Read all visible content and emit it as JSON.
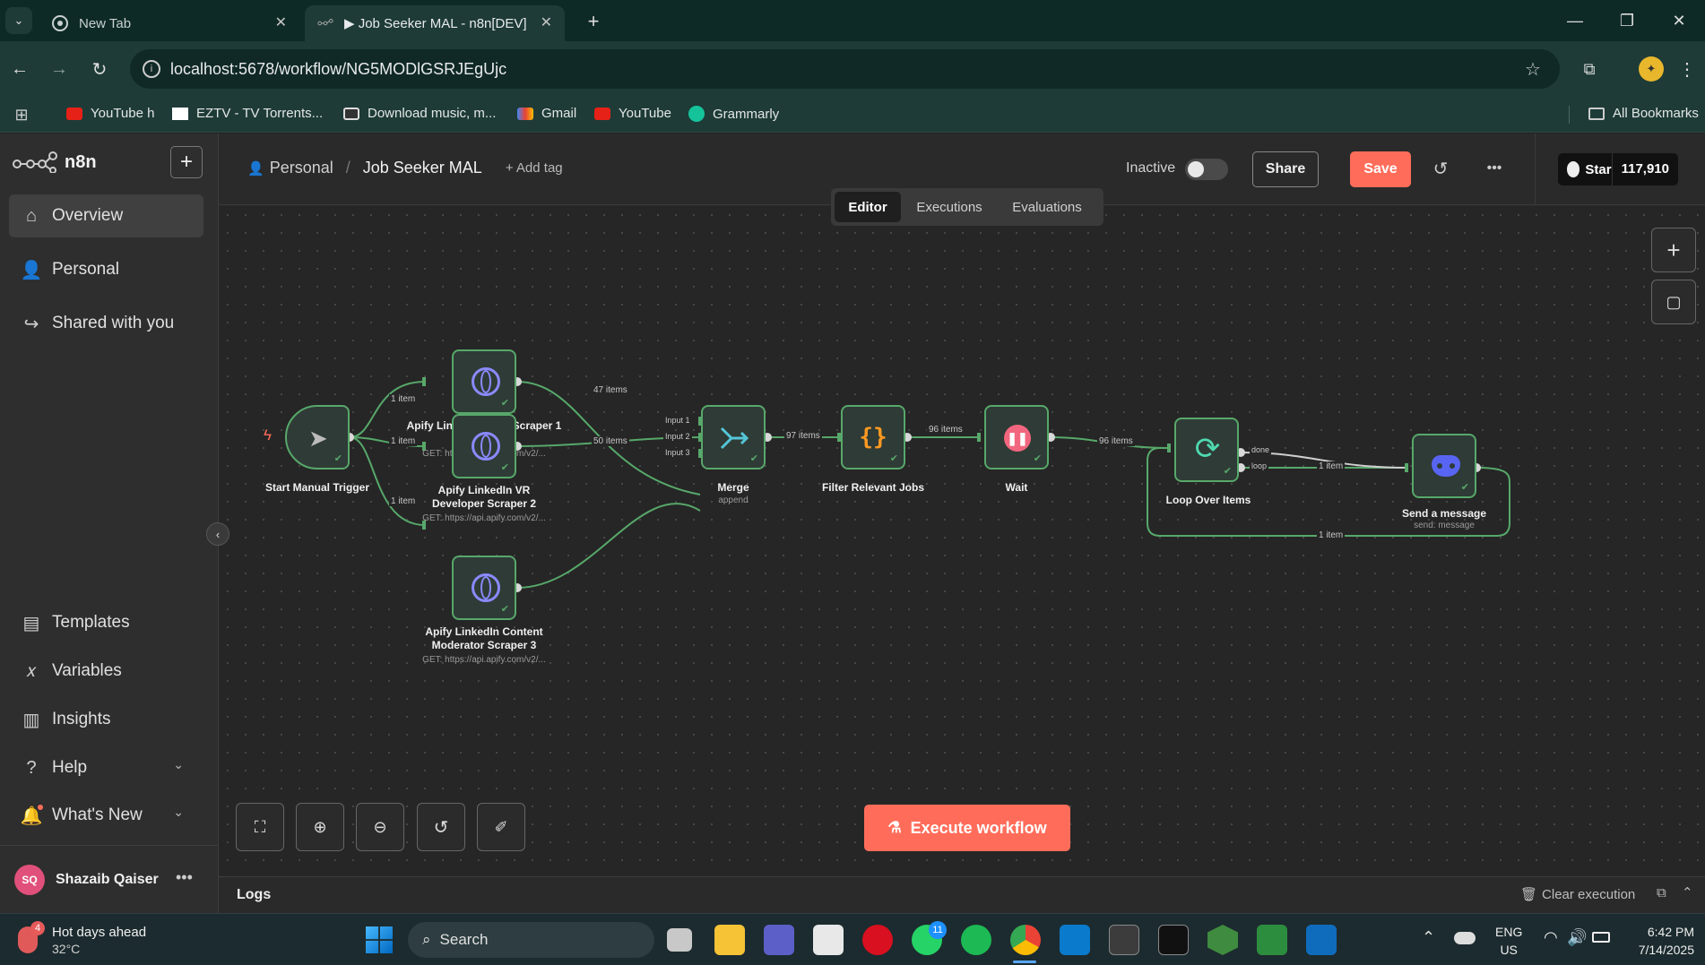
{
  "browser": {
    "tabs": [
      {
        "title": "New Tab"
      },
      {
        "title": "▶ Job Seeker MAL - n8n[DEV]"
      }
    ],
    "url": "localhost:5678/workflow/NG5MODlGSRJEgUjc",
    "bookmarks": [
      "YouTube h",
      "EZTV - TV Torrents...",
      "Download music, m...",
      "Gmail",
      "YouTube",
      "Grammarly"
    ],
    "all_bookmarks": "All Bookmarks"
  },
  "app": {
    "logo": "n8n",
    "nav_top": [
      "Overview",
      "Personal",
      "Shared with you"
    ],
    "nav_bottom": [
      "Templates",
      "Variables",
      "Insights",
      "Help",
      "What's New"
    ],
    "user": {
      "initials": "SQ",
      "name": "Shazaib Qaiser"
    }
  },
  "header": {
    "project": "Personal",
    "workflow_name": "Job Seeker MAL",
    "add_tag": "+ Add tag",
    "status": "Inactive",
    "share": "Share",
    "save": "Save",
    "github_star": "Star",
    "github_count": "117,910",
    "tabs": [
      "Editor",
      "Executions",
      "Evaluations"
    ]
  },
  "workflow": {
    "nodes": [
      {
        "name": "Start Manual Trigger",
        "sub": ""
      },
      {
        "name": "Apify LinkedIn unity Scraper 1",
        "sub": "GET: https://api.apify.com/v2/..."
      },
      {
        "name": "Apify LinkedIn VR Developer Scraper 2",
        "sub": "GET: https://api.apify.com/v2/..."
      },
      {
        "name": "Apify LinkedIn Content Moderator Scraper 3",
        "sub": "GET: https://api.apify.com/v2/..."
      },
      {
        "name": "Merge",
        "sub": "append"
      },
      {
        "name": "Filter Relevant Jobs",
        "sub": ""
      },
      {
        "name": "Wait",
        "sub": ""
      },
      {
        "name": "Loop Over Items",
        "sub": ""
      },
      {
        "name": "Send a message",
        "sub": "send: message"
      }
    ],
    "edges": {
      "t1": "1 item",
      "t2": "1 item",
      "t3": "1 item",
      "s1": "47 items",
      "s2": "50 items",
      "m": "97 items",
      "f": "96 items",
      "w": "96 items",
      "lp": "1 item",
      "back": "1 item"
    },
    "ports": {
      "in1": "Input 1",
      "in2": "Input 2",
      "in3": "Input 3",
      "done": "done",
      "loop": "loop"
    }
  },
  "execute_label": "Execute workflow",
  "logs": {
    "title": "Logs",
    "clear": "Clear execution"
  },
  "taskbar": {
    "weather_title": "Hot days ahead",
    "weather_temp": "32°C",
    "search": "Search",
    "lang1": "ENG",
    "lang2": "US",
    "time": "6:42 PM",
    "date": "7/14/2025",
    "whatsapp_badge": "11",
    "weather_badge": "4"
  }
}
